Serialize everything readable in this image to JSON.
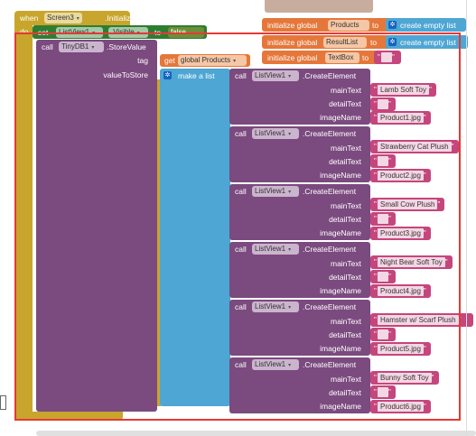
{
  "event": {
    "when_label": "when",
    "component": "Screen3",
    "event_name": ".Initialize",
    "do_label": "do"
  },
  "set_block": {
    "set_label": "set",
    "component": "ListView1",
    "property": ".Visible",
    "to_label": "to",
    "value": "false"
  },
  "globals": [
    {
      "init_label": "initialize global",
      "name": "Products",
      "to_label": "to",
      "value": "create empty list"
    },
    {
      "init_label": "initialize global",
      "name": "ResultList",
      "to_label": "to",
      "value": "create empty list"
    },
    {
      "init_label": "initialize global",
      "name": "TextBox",
      "to_label": "to"
    }
  ],
  "store": {
    "call_label": "call",
    "component": "TinyDB1",
    "method": ".StoreValue",
    "tag_label": "tag",
    "get_label": "get",
    "tag_value": "global Products",
    "value_label": "valueToStore",
    "make_list_label": "make a list"
  },
  "create_element": {
    "call_label": "call",
    "component": "ListView1",
    "method": ".CreateElement",
    "main_label": "mainText",
    "detail_label": "detailText",
    "image_label": "imageName"
  },
  "products": [
    {
      "main": "Lamb Soft Toy",
      "image": "Product1.jpg"
    },
    {
      "main": "Strawberry Cat Plush",
      "image": "Product2.jpg"
    },
    {
      "main": "Small Cow Plush",
      "image": "Product3.jpg"
    },
    {
      "main": "Night Bear Soft Toy",
      "image": "Product4.jpg"
    },
    {
      "main": "Hamster w/ Scarf Plush",
      "image": "Product5.jpg"
    },
    {
      "main": "Bunny Soft Toy",
      "image": "Product6.jpg"
    }
  ],
  "colors": {
    "event": "#c8a52c",
    "setter": "#2e7d32",
    "procedure": "#7b4a7f",
    "variable": "#e5773a",
    "list": "#4ea6d4",
    "text": "#c5467c",
    "highlight": "#e53935"
  }
}
